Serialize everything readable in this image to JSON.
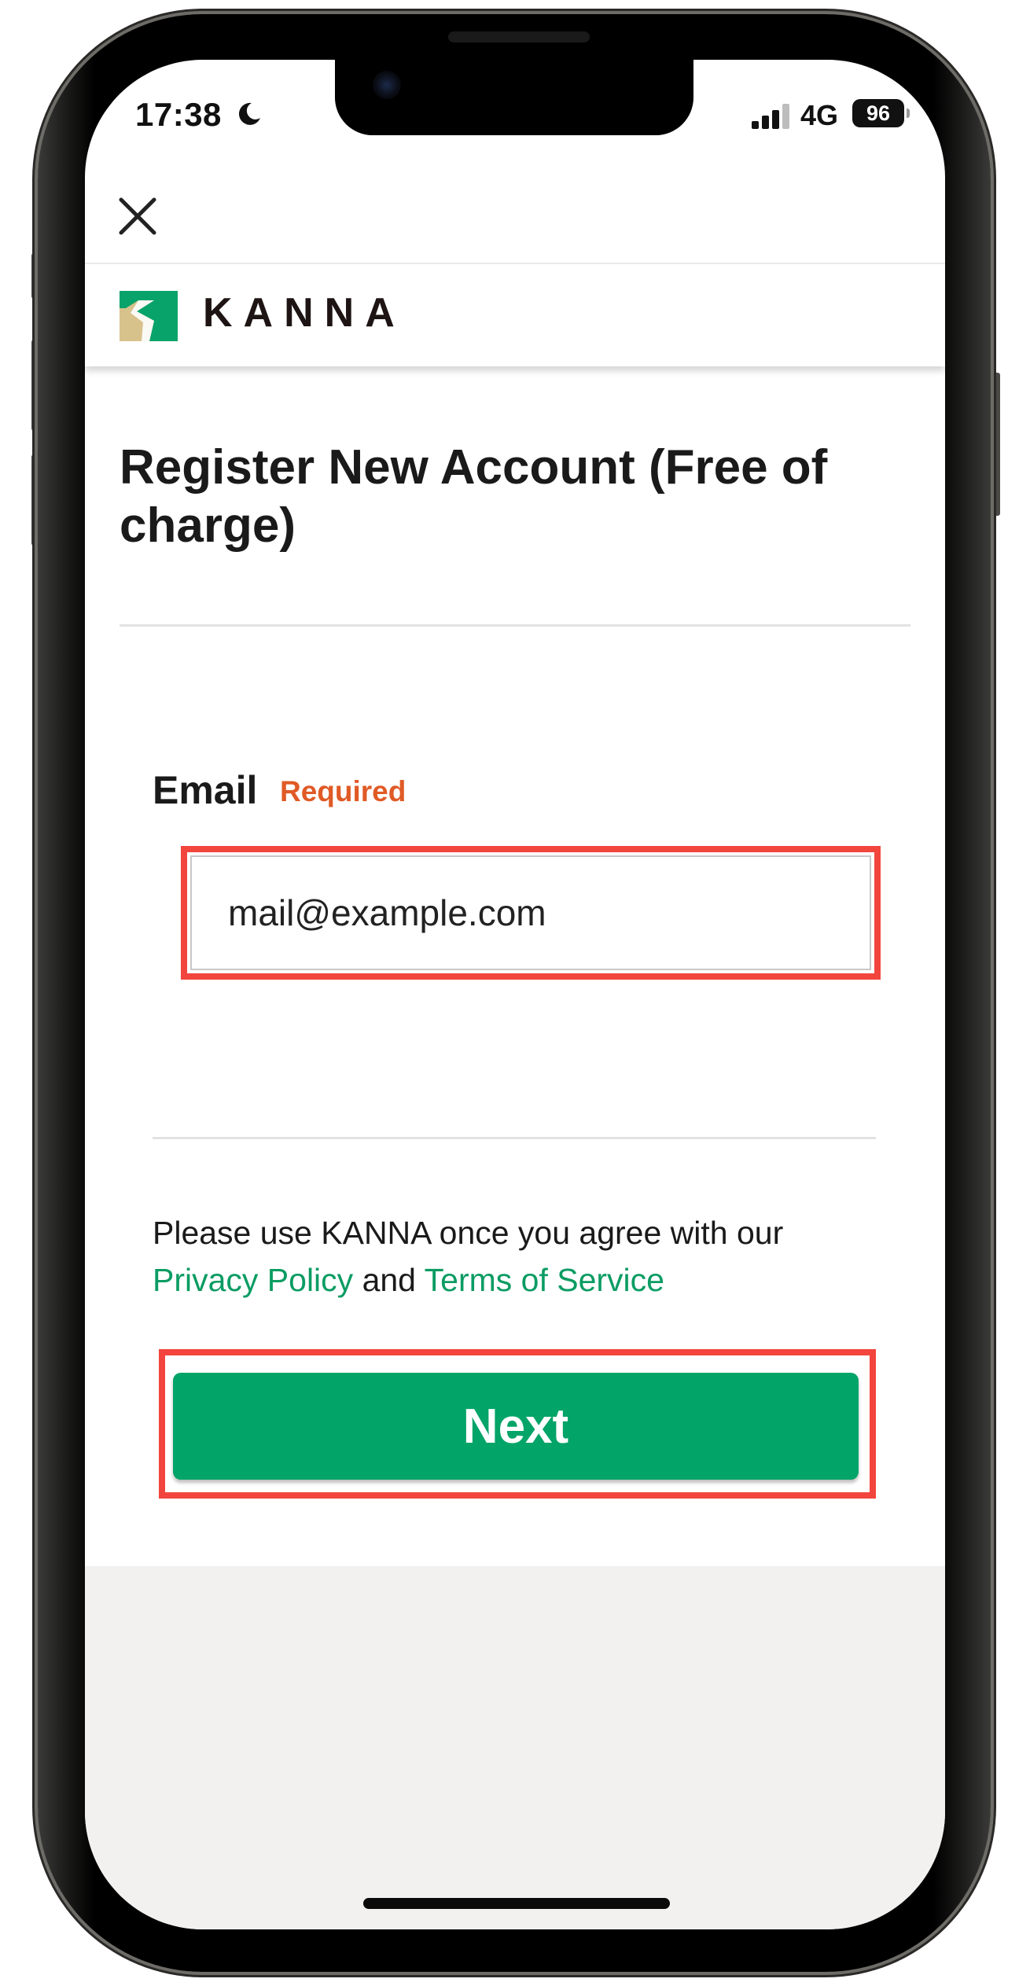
{
  "status_bar": {
    "time": "17:38",
    "network": "4G",
    "battery": "96",
    "icons": [
      "moon-icon",
      "signal-icon"
    ]
  },
  "nav": {
    "close_icon": "close-icon"
  },
  "header": {
    "brand": "KANNA",
    "logo_colors": {
      "green": "#08a36a",
      "sand": "#d8c28c"
    }
  },
  "form": {
    "title": "Register New Account (Free of charge)",
    "email_label": "Email",
    "required_label": "Required",
    "email_placeholder": "mail@example.com",
    "email_value": ""
  },
  "consent": {
    "prefix": "Please use KANNA once you agree with our",
    "privacy_link": "Privacy Policy",
    "and": "and",
    "terms_link": "Terms of Service"
  },
  "actions": {
    "next_label": "Next"
  },
  "colors": {
    "accent_green": "#02a468",
    "link_green": "#0b9c63",
    "required_orange": "#e05a26",
    "highlight_red": "#f2453d",
    "footer_bg": "#f2f1ef"
  }
}
